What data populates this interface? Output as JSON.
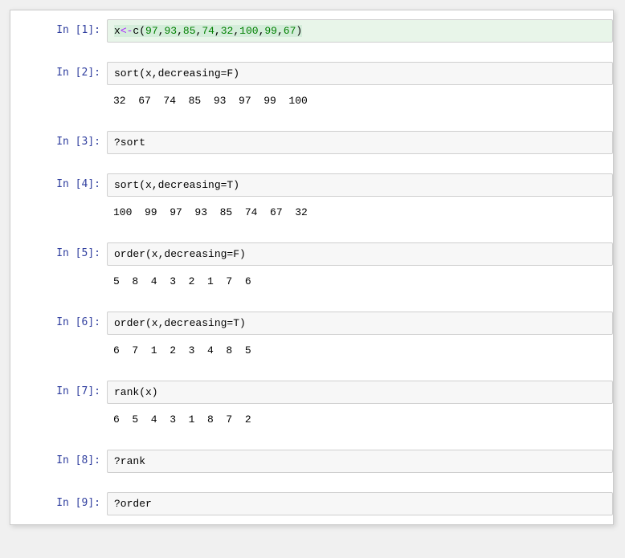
{
  "cells": [
    {
      "prompt": "In  [1]:",
      "type": "code",
      "highlighted": true,
      "tokens": [
        {
          "cls": "t-sel",
          "children": [
            {
              "cls": "t-var",
              "text": "x"
            },
            {
              "cls": "t-op",
              "text": "<-"
            },
            {
              "cls": "t-fn",
              "text": "c"
            },
            {
              "cls": "t-p",
              "text": "("
            },
            {
              "cls": "t-num",
              "text": "97"
            },
            {
              "cls": "t-p",
              "text": ","
            },
            {
              "cls": "t-num",
              "text": "93"
            },
            {
              "cls": "t-p",
              "text": ","
            },
            {
              "cls": "t-num",
              "text": "85"
            },
            {
              "cls": "t-p",
              "text": ","
            },
            {
              "cls": "t-num",
              "text": "74"
            },
            {
              "cls": "t-p",
              "text": ","
            },
            {
              "cls": "t-num",
              "text": "32"
            },
            {
              "cls": "t-p",
              "text": ","
            },
            {
              "cls": "t-num",
              "text": "100"
            },
            {
              "cls": "t-p",
              "text": ","
            },
            {
              "cls": "t-num",
              "text": "99"
            },
            {
              "cls": "t-p",
              "text": ","
            },
            {
              "cls": "t-num",
              "text": "67"
            },
            {
              "cls": "t-p",
              "text": ")"
            }
          ]
        }
      ]
    },
    {
      "type": "gap"
    },
    {
      "prompt": "In  [2]:",
      "type": "code",
      "code": "sort(x,decreasing=F)"
    },
    {
      "prompt": "",
      "type": "output",
      "text": "32  67  74  85  93  97  99  100"
    },
    {
      "type": "gap"
    },
    {
      "prompt": "In  [3]:",
      "type": "code",
      "code": "?sort"
    },
    {
      "type": "gap"
    },
    {
      "prompt": "In  [4]:",
      "type": "code",
      "code": "sort(x,decreasing=T)"
    },
    {
      "prompt": "",
      "type": "output",
      "text": "100  99  97  93  85  74  67  32"
    },
    {
      "type": "gap"
    },
    {
      "prompt": "In  [5]:",
      "type": "code",
      "code": "order(x,decreasing=F)"
    },
    {
      "prompt": "",
      "type": "output",
      "text": "5  8  4  3  2  1  7  6"
    },
    {
      "type": "gap"
    },
    {
      "prompt": "In  [6]:",
      "type": "code",
      "code": "order(x,decreasing=T)"
    },
    {
      "prompt": "",
      "type": "output",
      "text": "6  7  1  2  3  4  8  5"
    },
    {
      "type": "gap"
    },
    {
      "prompt": "In  [7]:",
      "type": "code",
      "code": "rank(x)"
    },
    {
      "prompt": "",
      "type": "output",
      "text": "6  5  4  3  1  8  7  2"
    },
    {
      "type": "gap"
    },
    {
      "prompt": "In  [8]:",
      "type": "code",
      "code": "?rank"
    },
    {
      "type": "gap"
    },
    {
      "prompt": "In  [9]:",
      "type": "code",
      "code": "?order"
    }
  ]
}
